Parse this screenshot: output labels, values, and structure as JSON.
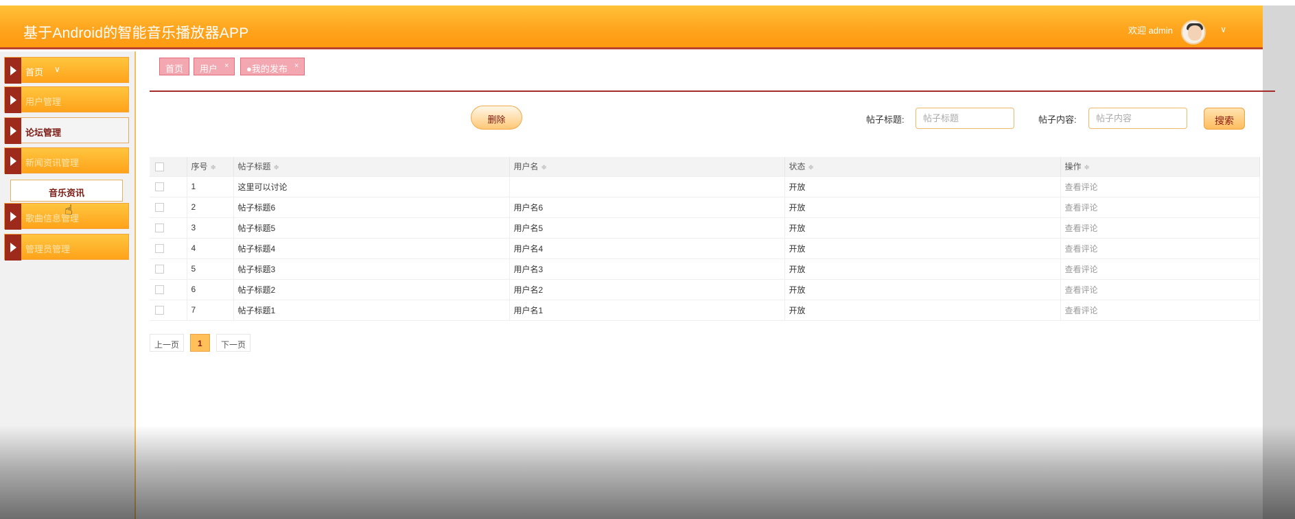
{
  "header": {
    "title": "基于Android的智能音乐播放器APP",
    "welcome": "欢迎 admin",
    "avatar_icon": "user-avatar",
    "chevron_icon": "chevron-down-icon",
    "accent_color": "#ffa51e",
    "border_color": "#b8422b"
  },
  "sidebar": {
    "items": [
      {
        "label": "首页",
        "chevron": "∨"
      },
      {
        "label": "用户管理"
      },
      {
        "label": "论坛管理"
      },
      {
        "label": "新闻资讯管理"
      },
      {
        "label": "歌曲信息管理"
      },
      {
        "label": "管理员管理"
      }
    ],
    "submenu": {
      "label": "音乐资讯"
    }
  },
  "tabs": [
    {
      "label": "首页",
      "closable": false
    },
    {
      "label": "用户",
      "close": "×"
    },
    {
      "label": "●我的发布",
      "close": "×"
    }
  ],
  "toolbar": {
    "delete_label": "删除",
    "title_label": "帖子标题:",
    "title_placeholder": "帖子标题",
    "content_label": "帖子内容:",
    "content_placeholder": "帖子内容",
    "search_label": "搜索"
  },
  "table": {
    "columns": [
      "",
      "序号",
      "帖子标题",
      "用户名",
      "状态",
      "操作"
    ],
    "sort_icon": "≑",
    "rows": [
      {
        "index": "1",
        "title": "这里可以讨论",
        "user": "",
        "status": "开放",
        "action": "查看评论"
      },
      {
        "index": "2",
        "title": "帖子标题6",
        "user": "用户名6",
        "status": "开放",
        "action": "查看评论"
      },
      {
        "index": "3",
        "title": "帖子标题5",
        "user": "用户名5",
        "status": "开放",
        "action": "查看评论"
      },
      {
        "index": "4",
        "title": "帖子标题4",
        "user": "用户名4",
        "status": "开放",
        "action": "查看评论"
      },
      {
        "index": "5",
        "title": "帖子标题3",
        "user": "用户名3",
        "status": "开放",
        "action": "查看评论"
      },
      {
        "index": "6",
        "title": "帖子标题2",
        "user": "用户名2",
        "status": "开放",
        "action": "查看评论"
      },
      {
        "index": "7",
        "title": "帖子标题1",
        "user": "用户名1",
        "status": "开放",
        "action": "查看评论"
      }
    ]
  },
  "pagination": {
    "prev": "上一页",
    "current": "1",
    "next": "下一页"
  }
}
